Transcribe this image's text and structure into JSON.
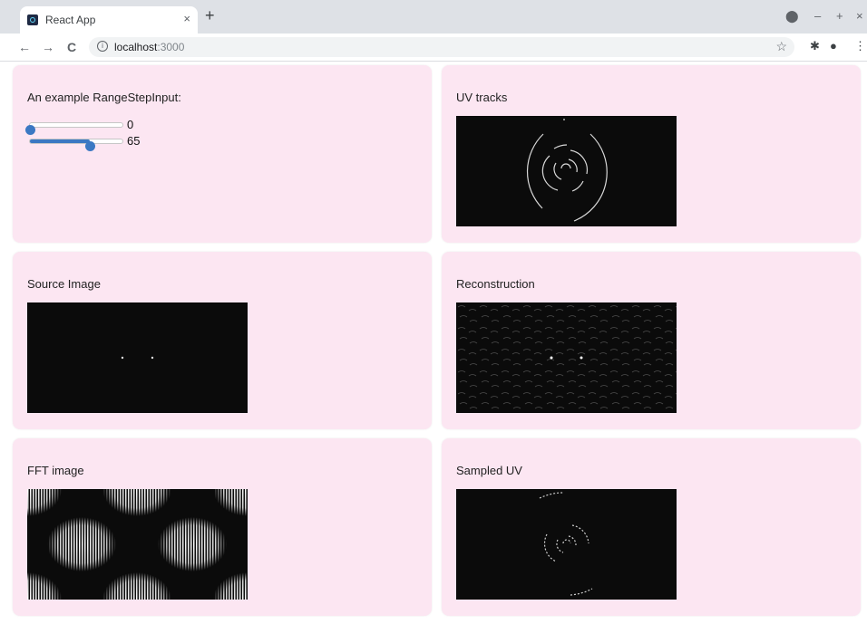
{
  "browser": {
    "tab_title": "React App",
    "tab_close": "×",
    "new_tab": "+",
    "url_host": "localhost",
    "url_port": ":3000",
    "nav_back": "←",
    "nav_forward": "→",
    "nav_reload": "C",
    "bookmark": "☆"
  },
  "panels": {
    "slider_panel": {
      "title": "An example RangeStepInput:",
      "sliders": [
        {
          "value_label": "0",
          "fraction": 0.0
        },
        {
          "value_label": "65",
          "fraction": 0.65
        }
      ]
    },
    "uv_tracks": {
      "title": "UV tracks"
    },
    "source_image": {
      "title": "Source Image"
    },
    "reconstruction": {
      "title": "Reconstruction"
    },
    "fft_image": {
      "title": "FFT image"
    },
    "sampled_uv": {
      "title": "Sampled UV"
    }
  },
  "colors": {
    "panel_bg": "#fce6f2",
    "slider_accent": "#3b78c3",
    "canvas_bg": "#0b0b0b"
  },
  "icons": [
    "react-favicon",
    "info-icon",
    "star-icon",
    "extensions-icon",
    "profile-icon",
    "menu-icon",
    "record-icon"
  ]
}
